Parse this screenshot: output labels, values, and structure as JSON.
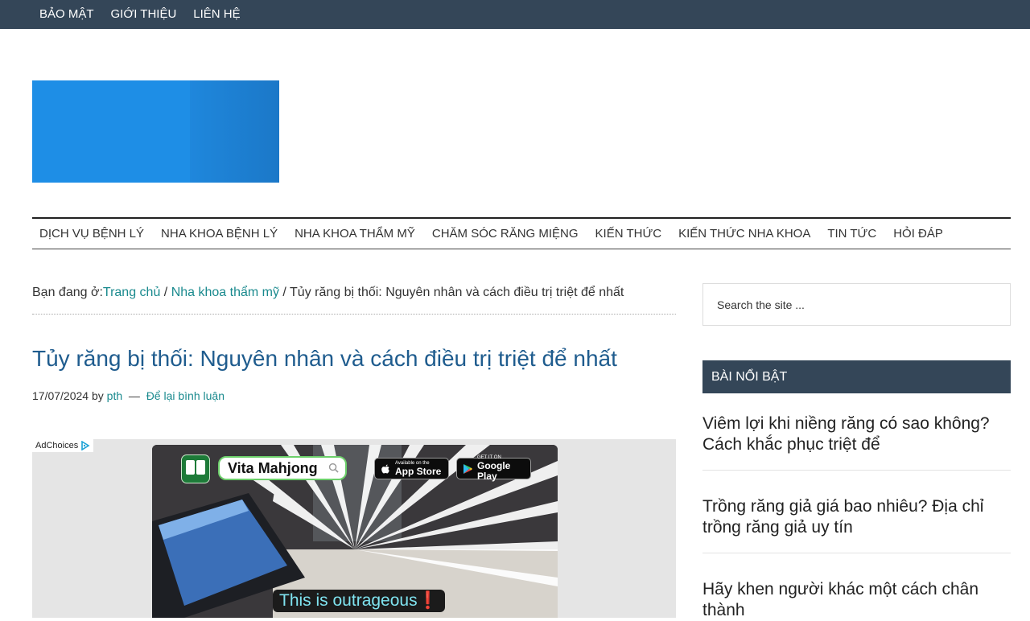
{
  "topnav": {
    "items": [
      {
        "label": "BẢO MẬT"
      },
      {
        "label": "GIỚI THIỆU"
      },
      {
        "label": "LIÊN HỆ"
      }
    ]
  },
  "header": {
    "logo_color": "#1e8ee6"
  },
  "mainnav": {
    "items": [
      {
        "label": "DỊCH VỤ BỆNH LÝ"
      },
      {
        "label": "NHA KHOA BỆNH LÝ"
      },
      {
        "label": "NHA KHOA THẨM MỸ"
      },
      {
        "label": "CHĂM SÓC RĂNG MIỆNG"
      },
      {
        "label": "KIẾN THỨC"
      },
      {
        "label": "KIẾN THỨC NHA KHOA"
      },
      {
        "label": "TIN TỨC"
      },
      {
        "label": "HỎI ĐÁP"
      }
    ]
  },
  "breadcrumb": {
    "prefix": "Bạn đang ở:",
    "home": "Trang chủ",
    "sep": " / ",
    "category": "Nha khoa thẩm mỹ",
    "current": "Tủy răng bị thối: Nguyên nhân và cách điều trị triệt để nhất"
  },
  "article": {
    "title": "Tủy răng bị thối: Nguyên nhân và cách điều trị triệt để nhất",
    "date": "17/07/2024",
    "by": "by",
    "author": "pth",
    "dash": "—",
    "comment_link": "Để lại bình luận"
  },
  "ad": {
    "adchoices": "AdChoices",
    "app_name": "Vita Mahjong",
    "appstore_small": "Available on the",
    "appstore_big": "App Store",
    "gplay_small": "GET IT ON",
    "gplay_big": "Google Play",
    "caption": "This is outrageous❗"
  },
  "sidebar": {
    "search_placeholder": "Search the site ...",
    "widget_title": "BÀI NỔI BẬT",
    "featured": [
      {
        "title": "Viêm lợi khi niềng răng có sao không? Cách khắc phục triệt để"
      },
      {
        "title": "Trồng răng giả giá bao nhiêu? Địa chỉ trồng răng giả uy tín"
      },
      {
        "title": "Hãy khen người khác một cách chân thành"
      }
    ]
  },
  "colors": {
    "topbar": "#344658",
    "link": "#1a8a8e",
    "title": "#1f5c8e"
  }
}
